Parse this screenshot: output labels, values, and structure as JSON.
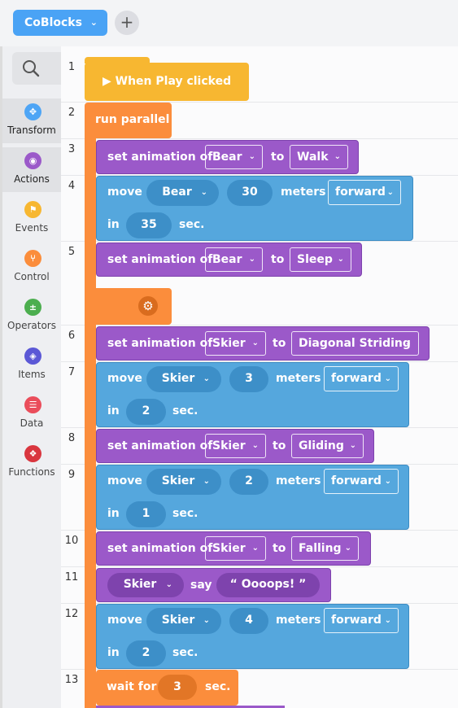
{
  "header": {
    "language_label": "CoBlocks",
    "add_symbol": "+"
  },
  "sidebar": {
    "search_icon": "search-icon",
    "categories": [
      {
        "label": "Transform",
        "icon": "move-icon",
        "color": "#4ea5f5",
        "active": true
      },
      {
        "label": "Actions",
        "icon": "eye-icon",
        "color": "#9b59c9",
        "active": true
      },
      {
        "label": "Events",
        "icon": "flag-icon",
        "color": "#f7b731"
      },
      {
        "label": "Control",
        "icon": "branch-icon",
        "color": "#fb8d3c"
      },
      {
        "label": "Operators",
        "icon": "plus-percent-icon",
        "color": "#4cae4f"
      },
      {
        "label": "Items",
        "icon": "cube-icon",
        "color": "#5b58d6"
      },
      {
        "label": "Data",
        "icon": "list-icon",
        "color": "#ea4d5b"
      },
      {
        "label": "Functions",
        "icon": "function-icon",
        "color": "#d9363f"
      }
    ]
  },
  "editor": {
    "line_numbers": [
      "1",
      "2",
      "3",
      "4",
      "5",
      "6",
      "7",
      "8",
      "9",
      "10",
      "11",
      "12",
      "13"
    ],
    "event_block": "▶ When Play clicked",
    "parallel_block": "run parallel",
    "set_anim_label": "set animation of",
    "to_label": "to",
    "move_label": "move",
    "meters_label": "meters",
    "in_label": "in",
    "sec_label": "sec.",
    "say_label": "say",
    "wait_label": "wait for",
    "rows": [
      {
        "object": "Bear",
        "animation": "Walk"
      },
      {
        "object": "Bear",
        "distance": "30",
        "direction": "forward",
        "time": "35"
      },
      {
        "object": "Bear",
        "animation": "Sleep"
      },
      {
        "object": "Skier",
        "animation": "Diagonal Striding"
      },
      {
        "object": "Skier",
        "distance": "3",
        "direction": "forward",
        "time": "2"
      },
      {
        "object": "Skier",
        "animation": "Gliding"
      },
      {
        "object": "Skier",
        "distance": "2",
        "direction": "forward",
        "time": "1"
      },
      {
        "object": "Skier",
        "animation": "Falling"
      },
      {
        "object": "Skier",
        "speech": "“ Oooops! ”"
      },
      {
        "object": "Skier",
        "distance": "4",
        "direction": "forward",
        "time": "2"
      },
      {
        "wait": "3"
      }
    ]
  }
}
